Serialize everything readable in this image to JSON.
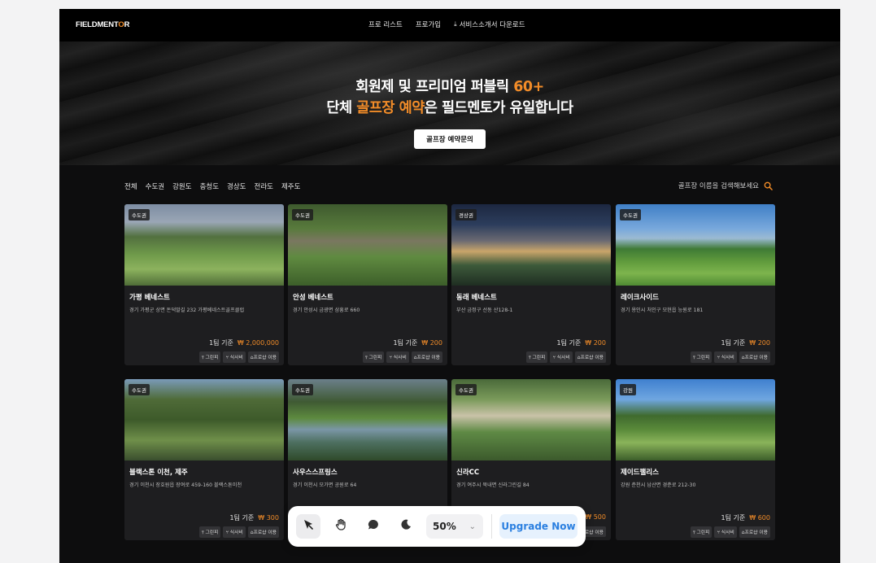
{
  "nav": {
    "logo_prefix": "FIELDMENT",
    "logo_accent": "O",
    "logo_suffix": "R",
    "links": [
      "프로 리스트",
      "프로가입",
      "서비스소개서 다운로드"
    ]
  },
  "hero": {
    "line1_text": "회원제 및 프리미엄 퍼블릭 ",
    "line1_accent": "60+",
    "line2_prefix": "단체 ",
    "line2_accent": "골프장 예약",
    "line2_suffix": "은 필드멘토가 유일합니다",
    "button_label": "골프장 예약문의"
  },
  "filters": [
    "전체",
    "수도권",
    "강원도",
    "충청도",
    "경상도",
    "전라도",
    "제주도"
  ],
  "search": {
    "placeholder": "골프장 이름을 검색해보세요"
  },
  "price_basis": "1팀 기준",
  "currency": "₩",
  "tag_labels": [
    "그린피",
    "식사비",
    "프로샵 이용"
  ],
  "cards": [
    {
      "region": "수도권",
      "name": "가평 베네스트",
      "address": "경기 가평군 상면 돈덕말길 232 가평베네스트골프클럽",
      "price": "2,000,000"
    },
    {
      "region": "수도권",
      "name": "안성 베네스트",
      "address": "경기 안성시 금광면 삼흥로 660",
      "price": "200"
    },
    {
      "region": "경상권",
      "name": "동래 베네스트",
      "address": "부산 금정구 선동 산128-1",
      "price": "200"
    },
    {
      "region": "수도권",
      "name": "레이크사이드",
      "address": "경기 용인시 처인구 모현읍 능원로 181",
      "price": "200"
    },
    {
      "region": "수도권",
      "name": "블랙스톤 이천, 제주",
      "address": "경기 이천시 장호원읍 장여로 459-160 블랙스톤이천",
      "price": "300"
    },
    {
      "region": "수도권",
      "name": "사우스스프링스",
      "address": "경기 이천시 모가면 공원로 64",
      "price": ""
    },
    {
      "region": "수도권",
      "name": "신라CC",
      "address": "경기 여주시 북내면 신라그린길 84",
      "price": "500"
    },
    {
      "region": "강원",
      "name": "제이드팰리스",
      "address": "강원 춘천시 남산면 경춘로 212-30",
      "price": "600"
    }
  ],
  "toolbar": {
    "zoom": "50%",
    "upgrade_label": "Upgrade Now"
  },
  "icons": [
    "download-icon",
    "search-icon",
    "cursor-icon",
    "hand-icon",
    "comment-icon",
    "moon-icon",
    "chevron-down-icon",
    "tee-icon",
    "utensils-icon",
    "shop-icon"
  ],
  "colors": {
    "accent": "#f28c28",
    "upgrade": "#2a7fe0"
  }
}
